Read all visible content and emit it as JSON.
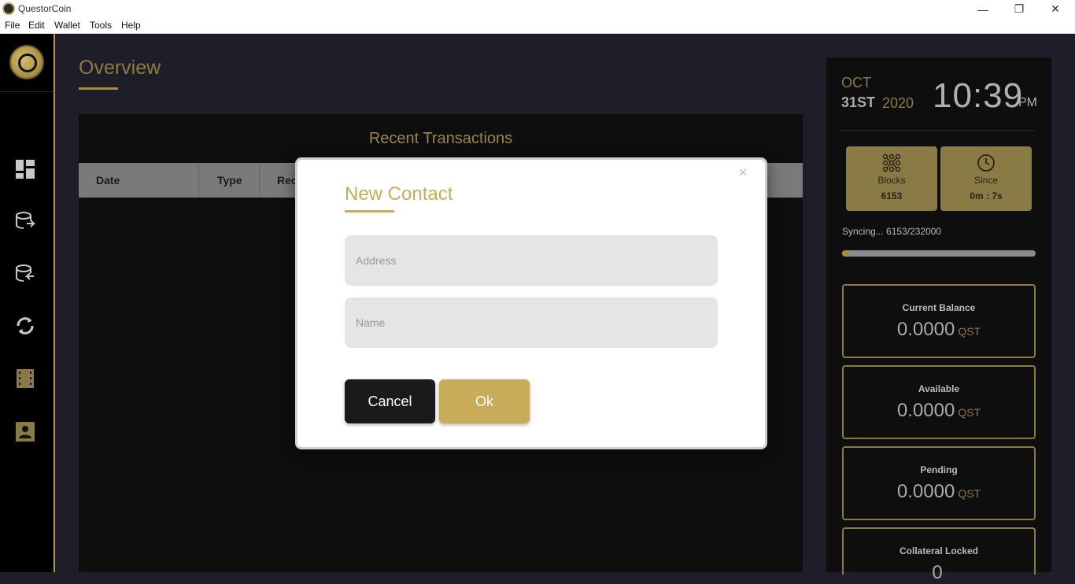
{
  "window": {
    "title": "QuestorCoin",
    "controls": {
      "minimize": "—",
      "maximize": "❐",
      "close": "✕"
    }
  },
  "menu": [
    "File",
    "Edit",
    "Wallet",
    "Tools",
    "Help"
  ],
  "sidebar": {
    "items": [
      {
        "name": "dashboard-icon"
      },
      {
        "name": "send-coins-icon"
      },
      {
        "name": "receive-coins-icon"
      },
      {
        "name": "sync-icon"
      },
      {
        "name": "transactions-icon"
      },
      {
        "name": "contacts-icon"
      }
    ]
  },
  "main": {
    "title": "Overview",
    "panel_title": "Recent Transactions",
    "columns": [
      "Date",
      "Type",
      "Rec"
    ]
  },
  "clock": {
    "month": "OCT",
    "day": "31ST",
    "year": "2020",
    "time": "10:39",
    "ampm": "PM"
  },
  "stats": {
    "blocks_label": "Blocks",
    "blocks_value": "6153",
    "since_label": "Since",
    "since_value": "0m : 7s"
  },
  "sync": {
    "text": "Syncing...  6153/232000",
    "progress": 0.0265
  },
  "balances": [
    {
      "label": "Current Balance",
      "amount": "0.0000",
      "unit": "QST"
    },
    {
      "label": "Available",
      "amount": "0.0000",
      "unit": "QST"
    },
    {
      "label": "Pending",
      "amount": "0.0000",
      "unit": "QST"
    },
    {
      "label": "Collateral Locked",
      "amount": "0",
      "unit": ""
    }
  ],
  "modal": {
    "title": "New Contact",
    "close": "×",
    "address_placeholder": "Address",
    "name_placeholder": "Name",
    "cancel_label": "Cancel",
    "ok_label": "Ok"
  },
  "colors": {
    "accent": "#c9ac5a",
    "sidebar_bg": "#000000",
    "main_bg": "#1e1e2a"
  }
}
